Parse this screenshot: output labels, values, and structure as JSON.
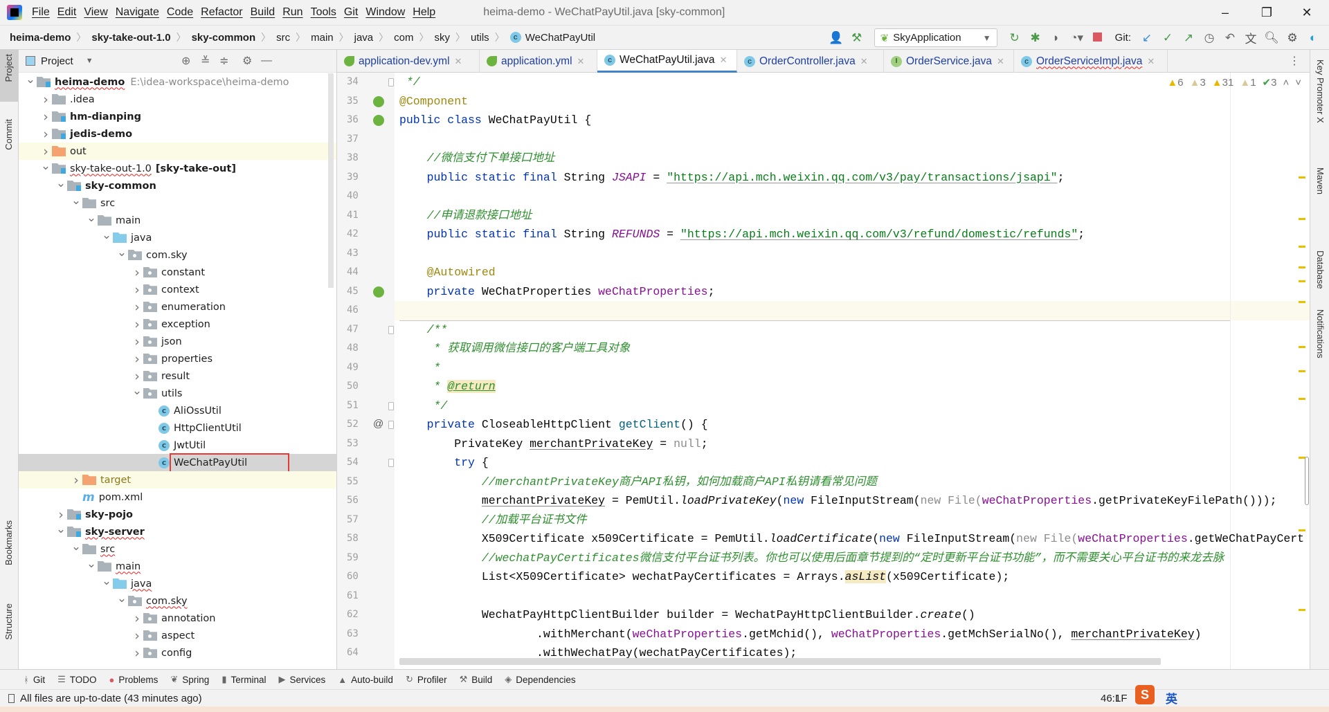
{
  "window": {
    "title": "heima-demo - WeChatPayUtil.java [sky-common]",
    "menu": [
      "File",
      "Edit",
      "View",
      "Navigate",
      "Code",
      "Refactor",
      "Build",
      "Run",
      "Tools",
      "Git",
      "Window",
      "Help"
    ]
  },
  "breadcrumb": [
    {
      "label": "heima-demo",
      "bold": true
    },
    {
      "label": "sky-take-out-1.0",
      "bold": true
    },
    {
      "label": "sky-common",
      "bold": true
    },
    {
      "label": "src"
    },
    {
      "label": "main"
    },
    {
      "label": "java"
    },
    {
      "label": "com"
    },
    {
      "label": "sky"
    },
    {
      "label": "utils"
    },
    {
      "label": "WeChatPayUtil",
      "icon": "class-icon"
    }
  ],
  "toolbar": {
    "run_config": "SkyApplication",
    "git_label": "Git:"
  },
  "left_strip": [
    "Project",
    "Commit",
    "Bookmarks",
    "Structure"
  ],
  "right_strip": [
    "Key Promoter X",
    "Maven",
    "Database",
    "Notifications"
  ],
  "project": {
    "title": "Project",
    "tree": [
      {
        "label": "heima-demo",
        "extra": "E:\\idea-workspace\\heima-demo",
        "depth": 0,
        "arrow": "open",
        "icon": "mod",
        "bold": true,
        "wavy": true
      },
      {
        "label": ".idea",
        "depth": 1,
        "arrow": "closed",
        "icon": "folder"
      },
      {
        "label": "hm-dianping",
        "depth": 1,
        "arrow": "closed",
        "icon": "mod",
        "bold": true
      },
      {
        "label": "jedis-demo",
        "depth": 1,
        "arrow": "closed",
        "icon": "mod",
        "bold": true
      },
      {
        "label": "out",
        "depth": 1,
        "arrow": "closed",
        "icon": "out",
        "highlight": true
      },
      {
        "label": "sky-take-out-1.0",
        "extra_bold": "[sky-take-out]",
        "depth": 1,
        "arrow": "open",
        "icon": "mod",
        "wavy": true
      },
      {
        "label": "sky-common",
        "depth": 2,
        "arrow": "open",
        "icon": "mod",
        "bold": true
      },
      {
        "label": "src",
        "depth": 3,
        "arrow": "open",
        "icon": "folder"
      },
      {
        "label": "main",
        "depth": 4,
        "arrow": "open",
        "icon": "folder"
      },
      {
        "label": "java",
        "depth": 5,
        "arrow": "open",
        "icon": "java"
      },
      {
        "label": "com.sky",
        "depth": 6,
        "arrow": "open",
        "icon": "pkg"
      },
      {
        "label": "constant",
        "depth": 7,
        "arrow": "closed",
        "icon": "pkg"
      },
      {
        "label": "context",
        "depth": 7,
        "arrow": "closed",
        "icon": "pkg"
      },
      {
        "label": "enumeration",
        "depth": 7,
        "arrow": "closed",
        "icon": "pkg"
      },
      {
        "label": "exception",
        "depth": 7,
        "arrow": "closed",
        "icon": "pkg"
      },
      {
        "label": "json",
        "depth": 7,
        "arrow": "closed",
        "icon": "pkg"
      },
      {
        "label": "properties",
        "depth": 7,
        "arrow": "closed",
        "icon": "pkg"
      },
      {
        "label": "result",
        "depth": 7,
        "arrow": "closed",
        "icon": "pkg"
      },
      {
        "label": "utils",
        "depth": 7,
        "arrow": "open",
        "icon": "pkg"
      },
      {
        "label": "AliOssUtil",
        "depth": 8,
        "arrow": "none",
        "icon": "class"
      },
      {
        "label": "HttpClientUtil",
        "depth": 8,
        "arrow": "none",
        "icon": "class"
      },
      {
        "label": "JwtUtil",
        "depth": 8,
        "arrow": "none",
        "icon": "class"
      },
      {
        "label": "WeChatPayUtil",
        "depth": 8,
        "arrow": "none",
        "icon": "class",
        "selected": true
      },
      {
        "label": "target",
        "depth": 3,
        "arrow": "closed",
        "icon": "out",
        "highlight": true
      },
      {
        "label": "pom.xml",
        "depth": 3,
        "arrow": "none",
        "icon": "maven"
      },
      {
        "label": "sky-pojo",
        "depth": 2,
        "arrow": "closed",
        "icon": "mod",
        "bold": true
      },
      {
        "label": "sky-server",
        "depth": 2,
        "arrow": "open",
        "icon": "mod",
        "bold": true,
        "wavy": true
      },
      {
        "label": "src",
        "depth": 3,
        "arrow": "open",
        "icon": "folder",
        "wavy": true
      },
      {
        "label": "main",
        "depth": 4,
        "arrow": "open",
        "icon": "folder",
        "wavy": true
      },
      {
        "label": "java",
        "depth": 5,
        "arrow": "open",
        "icon": "java",
        "wavy": true
      },
      {
        "label": "com.sky",
        "depth": 6,
        "arrow": "open",
        "icon": "pkg",
        "wavy": true
      },
      {
        "label": "annotation",
        "depth": 7,
        "arrow": "closed",
        "icon": "pkg"
      },
      {
        "label": "aspect",
        "depth": 7,
        "arrow": "closed",
        "icon": "pkg"
      },
      {
        "label": "config",
        "depth": 7,
        "arrow": "closed",
        "icon": "pkg"
      }
    ]
  },
  "tabs": [
    {
      "label": "application-dev.yml",
      "icon": "spring"
    },
    {
      "label": "application.yml",
      "icon": "spring"
    },
    {
      "label": "WeChatPayUtil.java",
      "icon": "class",
      "active": true
    },
    {
      "label": "OrderController.java",
      "icon": "class"
    },
    {
      "label": "OrderService.java",
      "icon": "interface"
    },
    {
      "label": "OrderServiceImpl.java",
      "icon": "class",
      "wavy": true
    }
  ],
  "inspections": {
    "warnings": "6",
    "weak_warnings": "3",
    "typos": "31",
    "other": "1",
    "ok": "3"
  },
  "editor": {
    "first_line": 34,
    "current_line": 46,
    "lines": [
      [
        [
          " */",
          "d"
        ]
      ],
      [
        [
          "@Component",
          "a"
        ]
      ],
      [
        [
          "public class ",
          "k"
        ],
        [
          "WeChatPayUtil",
          "p"
        ],
        [
          " {",
          "p"
        ]
      ],
      [],
      [
        [
          "    //微信支付下单接口地址",
          "c"
        ]
      ],
      [
        [
          "    public static final ",
          "k"
        ],
        [
          "String ",
          "p"
        ],
        [
          "JSAPI",
          "sf"
        ],
        [
          " = ",
          "p"
        ],
        [
          "\"https://api.mch.weixin.qq.com/v3/pay/transactions/jsapi\"",
          "s"
        ],
        [
          ";",
          "p"
        ]
      ],
      [],
      [
        [
          "    //申请退款接口地址",
          "c"
        ]
      ],
      [
        [
          "    public static final ",
          "k"
        ],
        [
          "String ",
          "p"
        ],
        [
          "REFUNDS",
          "sf"
        ],
        [
          " = ",
          "p"
        ],
        [
          "\"https://api.mch.weixin.qq.com/v3/refund/domestic/refunds\"",
          "s"
        ],
        [
          ";",
          "p"
        ]
      ],
      [],
      [
        [
          "    ",
          "p"
        ],
        [
          "@Autowired",
          "a"
        ]
      ],
      [
        [
          "    private ",
          "k"
        ],
        [
          "WeChatProperties ",
          "p"
        ],
        [
          "weChatProperties",
          "f"
        ],
        [
          ";",
          "p"
        ]
      ],
      [],
      [
        [
          "    /**",
          "d"
        ]
      ],
      [
        [
          "     * 获取调用微信接口的客户端工具对象",
          "d"
        ]
      ],
      [
        [
          "     *",
          "d"
        ]
      ],
      [
        [
          "     * ",
          "d"
        ],
        [
          "@return",
          "dt"
        ]
      ],
      [
        [
          "     */",
          "d"
        ]
      ],
      [
        [
          "    private ",
          "k"
        ],
        [
          "CloseableHttpClient ",
          "p"
        ],
        [
          "getClient",
          "m"
        ],
        [
          "() {",
          "p"
        ]
      ],
      [
        [
          "        PrivateKey ",
          "p"
        ],
        [
          "merchantPrivateKey",
          "u"
        ],
        [
          " = ",
          "p"
        ],
        [
          "null",
          "n"
        ],
        [
          ";",
          "p"
        ]
      ],
      [
        [
          "        try",
          "k"
        ],
        [
          " {",
          "p"
        ]
      ],
      [
        [
          "            //merchantPrivateKey商户API私钥，如何加载商户API私钥请看常见问题",
          "c"
        ]
      ],
      [
        [
          "            ",
          "p"
        ],
        [
          "merchantPrivateKey",
          "u"
        ],
        [
          " = PemUtil.",
          "p"
        ],
        [
          "loadPrivateKey",
          "i"
        ],
        [
          "(",
          "p"
        ],
        [
          "new ",
          "k"
        ],
        [
          "FileInputStream(",
          "p"
        ],
        [
          "new File(",
          "n"
        ],
        [
          "weChatProperties",
          "f"
        ],
        [
          ".getPrivateKeyFilePath()));",
          "p"
        ]
      ],
      [
        [
          "            //加载平台证书文件",
          "c"
        ]
      ],
      [
        [
          "            X509Certificate x509Certificate = PemUtil.",
          "p"
        ],
        [
          "loadCertificate",
          "i"
        ],
        [
          "(",
          "p"
        ],
        [
          "new ",
          "k"
        ],
        [
          "FileInputStream(",
          "p"
        ],
        [
          "new File(",
          "n"
        ],
        [
          "weChatProperties",
          "f"
        ],
        [
          ".getWeChatPayCert",
          "p"
        ]
      ],
      [
        [
          "            //wechatPayCertificates微信支付平台证书列表。你也可以使用后面章节提到的“定时更新平台证书功能”，而不需要关心平台证书的来龙去脉",
          "c"
        ]
      ],
      [
        [
          "            List<X509Certificate> wechatPayCertificates = Arrays.",
          "p"
        ],
        [
          "asList",
          "ih"
        ],
        [
          "(x509Certificate);",
          "p"
        ]
      ],
      [],
      [
        [
          "            WechatPayHttpClientBuilder builder = WechatPayHttpClientBuilder.",
          "p"
        ],
        [
          "create",
          "i"
        ],
        [
          "()",
          "p"
        ]
      ],
      [
        [
          "                    .withMerchant(",
          "p"
        ],
        [
          "weChatProperties",
          "f"
        ],
        [
          ".getMchid(), ",
          "p"
        ],
        [
          "weChatProperties",
          "f"
        ],
        [
          ".getMchSerialNo(), ",
          "p"
        ],
        [
          "merchantPrivateKey",
          "u"
        ],
        [
          ")",
          "p"
        ]
      ],
      [
        [
          "                    .withWechatPay(wechatPayCertificates);",
          "p"
        ]
      ]
    ]
  },
  "bottom_tools": [
    {
      "label": "Git",
      "icon": "git-icon",
      "glyph": "ᚼ"
    },
    {
      "label": "TODO",
      "icon": "todo-icon",
      "glyph": "☰"
    },
    {
      "label": "Problems",
      "icon": "problems-icon",
      "glyph": "●"
    },
    {
      "label": "Spring",
      "icon": "spring-icon",
      "glyph": "❦"
    },
    {
      "label": "Terminal",
      "icon": "terminal-icon",
      "glyph": "▮"
    },
    {
      "label": "Services",
      "icon": "services-icon",
      "glyph": "▶"
    },
    {
      "label": "Auto-build",
      "icon": "auto-build-icon",
      "glyph": "▲"
    },
    {
      "label": "Profiler",
      "icon": "profiler-icon",
      "glyph": "↻"
    },
    {
      "label": "Build",
      "icon": "build-icon",
      "glyph": "⚒"
    },
    {
      "label": "Dependencies",
      "icon": "dependencies-icon",
      "glyph": "◈"
    }
  ],
  "status": {
    "message": "All files are up-to-date (43 minutes ago)",
    "position": "46:1",
    "line_sep": "LF",
    "ime": "英"
  },
  "colors": {
    "accent": "#4083c9",
    "selection_box": "#e53935",
    "keyword": "#0033b3",
    "string": "#067d17",
    "annotation": "#9e880d",
    "field": "#871094"
  }
}
